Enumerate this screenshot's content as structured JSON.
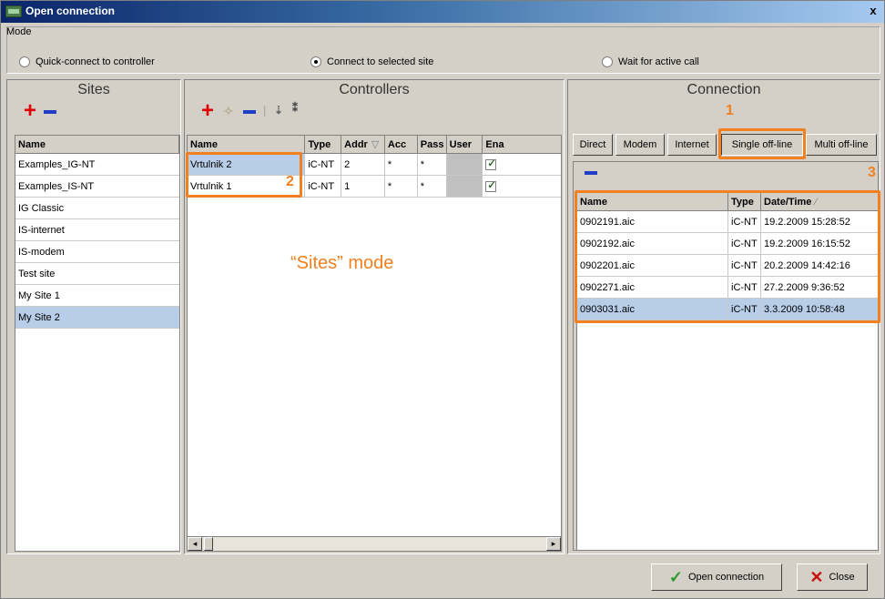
{
  "window": {
    "title": "Open connection",
    "close_label": "x"
  },
  "mode": {
    "label": "Mode",
    "options": [
      {
        "label": "Quick-connect to controller",
        "selected": false
      },
      {
        "label": "Connect to selected site",
        "selected": true
      },
      {
        "label": "Wait for active call",
        "selected": false
      }
    ]
  },
  "sites": {
    "title": "Sites",
    "header": "Name",
    "items": [
      "Examples_IG-NT",
      "Examples_IS-NT",
      "IG Classic",
      "IS-internet",
      "IS-modem",
      "Test site",
      "My Site 1",
      "My Site 2"
    ],
    "selected_index": 7
  },
  "controllers": {
    "title": "Controllers",
    "columns": [
      "Name",
      "Type",
      "Addr",
      "Acc",
      "Pass",
      "User",
      "Ena"
    ],
    "rows": [
      {
        "name": "Vrtulnik 2",
        "type": "iC-NT",
        "addr": "2",
        "acc": "*",
        "pass": "*",
        "user": "",
        "ena": true
      },
      {
        "name": "Vrtulnik 1",
        "type": "iC-NT",
        "addr": "1",
        "acc": "*",
        "pass": "*",
        "user": "",
        "ena": true
      }
    ],
    "annotation_mode": "“Sites” mode"
  },
  "connection": {
    "title": "Connection",
    "tabs": [
      "Direct",
      "Modem",
      "Internet",
      "Single off-line",
      "Multi off-line"
    ],
    "active_tab": "Single off-line",
    "columns": [
      "Name",
      "Type",
      "Date/Time"
    ],
    "rows": [
      {
        "name": "0902191.aic",
        "type": "iC-NT",
        "date": "19.2.2009 15:28:52"
      },
      {
        "name": "0902192.aic",
        "type": "iC-NT",
        "date": "19.2.2009 16:15:52"
      },
      {
        "name": "0902201.aic",
        "type": "iC-NT",
        "date": "20.2.2009 14:42:16"
      },
      {
        "name": "0902271.aic",
        "type": "iC-NT",
        "date": "27.2.2009 9:36:52"
      },
      {
        "name": "0903031.aic",
        "type": "iC-NT",
        "date": "3.3.2009 10:58:48"
      }
    ],
    "selected_index": 4
  },
  "annotations": {
    "n1": "1",
    "n2": "2",
    "n3": "3"
  },
  "buttons": {
    "open": "Open connection",
    "close": "Close"
  },
  "colors": {
    "accent_orange": "#f08020",
    "add_red": "#e00000",
    "remove_blue": "#1e3ec8",
    "selection": "#b8cde8"
  }
}
